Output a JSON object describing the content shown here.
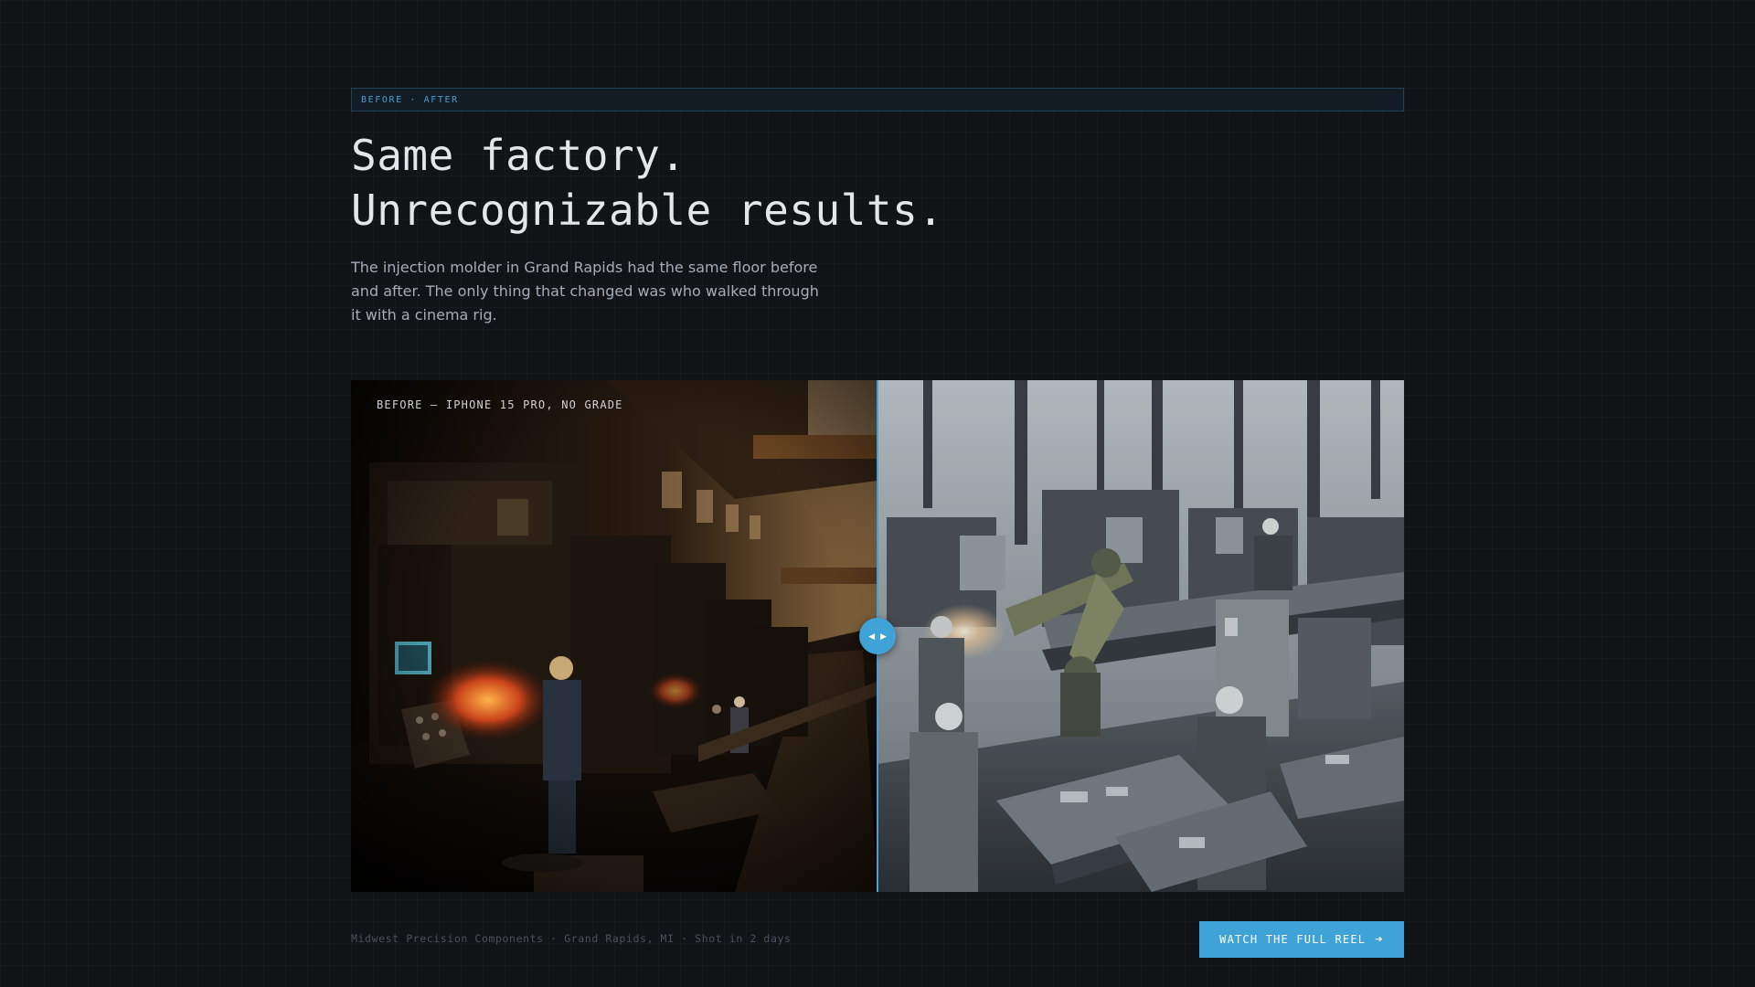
{
  "eyebrow": "BEFORE · AFTER",
  "headline": {
    "line1": "Same factory.",
    "line2": "Unrecognizable results."
  },
  "lede": "The injection molder in Grand Rapids had the same floor before and after. The only thing that changed was who walked through it with a cinema rig.",
  "comparison": {
    "before_label": "BEFORE — IPHONE 15 PRO, NO GRADE",
    "split_fraction": 0.5,
    "handle_icons": [
      "arrow-left-icon",
      "arrow-right-icon"
    ]
  },
  "footer": {
    "credit": "Midwest Precision Components · Grand Rapids, MI · Shot in 2 days",
    "cta_label": "WATCH THE FULL REEL",
    "cta_icon": "arrow-right-icon"
  },
  "colors": {
    "accent": "#3fa3d8",
    "background": "#111317"
  }
}
